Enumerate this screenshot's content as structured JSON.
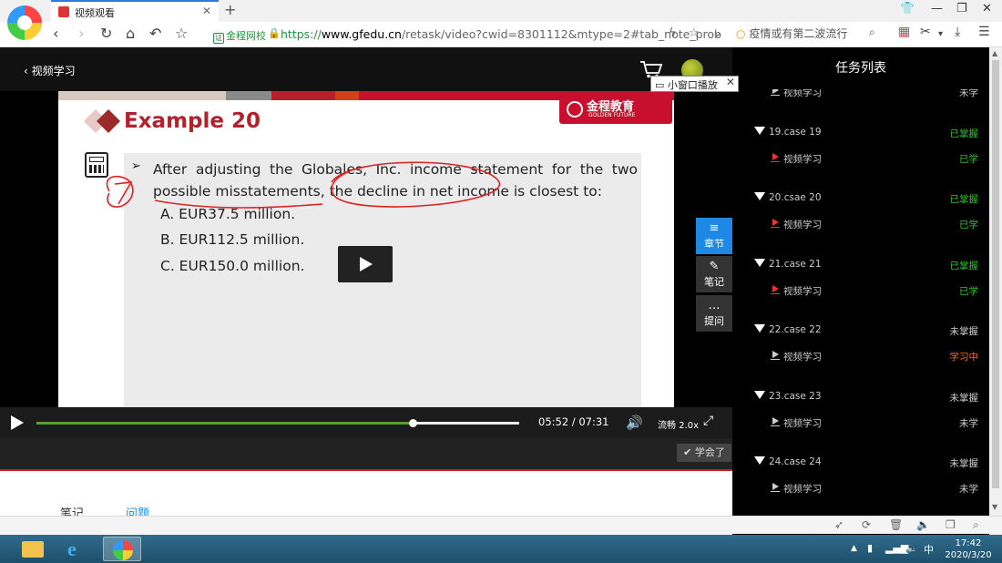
{
  "browser": {
    "tab_title": "视频观看",
    "tab_close": "✕",
    "new_tab": "+",
    "site_badge": "金程网校",
    "url_proto": "https://",
    "url_host": "www.gfedu.cn",
    "url_path": "/retask/video?cwid=8301112&mtype=2#tab_note_prob",
    "search_placeholder": "疫情或有第二波流行"
  },
  "header": {
    "back_label": "视频学习",
    "mini_window_label": "小窗口播放",
    "mini_window_close": "✕"
  },
  "slide": {
    "title": "Example 20",
    "logo_main": "金程教育",
    "logo_sub": "GOLDEN FUTURE",
    "bullet": "➢",
    "question": "After adjusting the Globales, Inc. income statement for the two possible misstatements, the decline in net income is closest to:",
    "options": [
      "A.  EUR37.5 million.",
      "B.  EUR112.5 million.",
      "C.  EUR150.0 million."
    ]
  },
  "side_tabs": [
    {
      "icon": "≡",
      "label": "章节"
    },
    {
      "icon": "✎",
      "label": "笔记"
    },
    {
      "icon": "…",
      "label": "提问"
    }
  ],
  "player": {
    "current_time": "05:52",
    "total_time": "07:31",
    "progress_fraction": 0.78,
    "quality_label": "流畅",
    "speed_label": "2.0x",
    "learned_label": "学会了"
  },
  "below_tabs": [
    "笔记",
    "问题"
  ],
  "task_panel": {
    "title": "任务列表",
    "chapters": [
      {
        "name": "",
        "status": "",
        "item": "视频学习",
        "item_status": "未学",
        "status_color": "#ccc",
        "item_color": "#ccc",
        "icon": "gray"
      },
      {
        "name": "19.case 19",
        "status": "已掌握",
        "item": "视频学习",
        "item_status": "已学",
        "status_color": "#31c131",
        "item_color": "#31c131",
        "icon": "red"
      },
      {
        "name": "20.csae 20",
        "status": "已掌握",
        "item": "视频学习",
        "item_status": "已学",
        "status_color": "#31c131",
        "item_color": "#31c131",
        "icon": "red"
      },
      {
        "name": "21.case 21",
        "status": "已掌握",
        "item": "视频学习",
        "item_status": "已学",
        "status_color": "#31c131",
        "item_color": "#31c131",
        "icon": "red"
      },
      {
        "name": "22.case 22",
        "status": "未掌握",
        "item": "视频学习",
        "item_status": "学习中",
        "status_color": "#ccc",
        "item_color": "#ff6a00",
        "icon": "gray"
      },
      {
        "name": "23.case 23",
        "status": "未掌握",
        "item": "视频学习",
        "item_status": "未学",
        "status_color": "#ccc",
        "item_color": "#ccc",
        "icon": "gray"
      },
      {
        "name": "24.case 24",
        "status": "未掌握",
        "item": "视频学习",
        "item_status": "未学",
        "status_color": "#ccc",
        "item_color": "#ccc",
        "icon": "gray"
      }
    ]
  },
  "clock": {
    "time": "17:42",
    "date": "2020/3/20"
  },
  "tray": {
    "ime": "中"
  },
  "colors": {
    "accent_blue": "#1e88e5",
    "mastered_green": "#31c131",
    "learning_orange": "#ff6a00",
    "title_red": "#b0232d",
    "progress_green": "#5aa02c"
  }
}
